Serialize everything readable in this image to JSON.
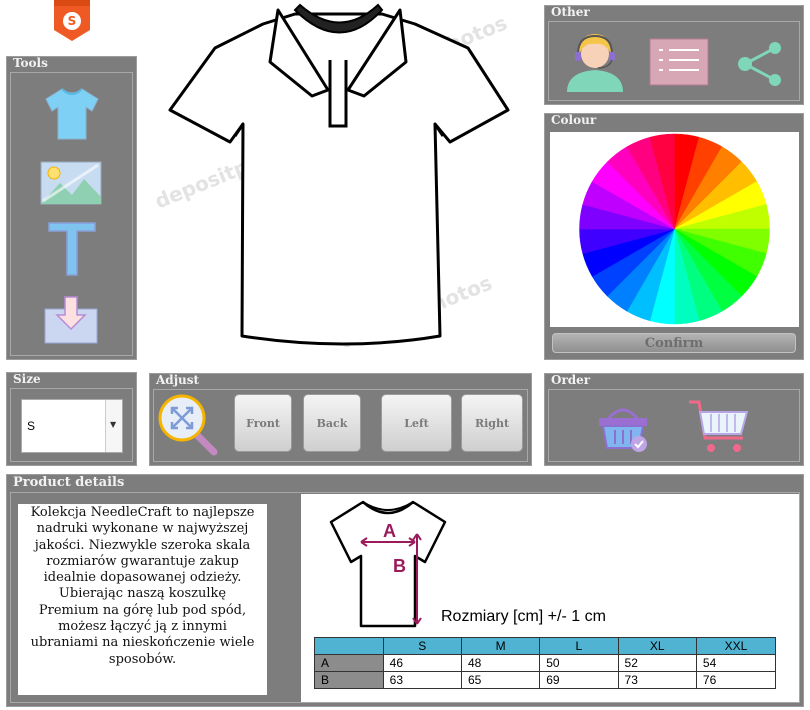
{
  "logo": {
    "letter": "S"
  },
  "panels": {
    "tools": "Tools",
    "other": "Other",
    "colour": "Colour",
    "size": "Size",
    "adjust": "Adjust",
    "order": "Order",
    "product_details": "Product details"
  },
  "colour": {
    "confirm_label": "Confirm"
  },
  "size_select": {
    "value": "S"
  },
  "adjust": {
    "buttons": [
      "Front",
      "Back",
      "Left",
      "Right"
    ]
  },
  "watermark": "depositphotos",
  "product": {
    "description": "Kolekcja NeedleCraft to najlepsze nadruki wykonane w najwyższej jakości. Niezwykle szeroka skala rozmiarów gwarantuje zakup idealnie dopasowanej odzieży. Ubierając naszą koszulkę Premium na górę lub pod spód, możesz łączyć ją z innymi ubraniami na nieskończenie wiele sposobów.",
    "diagram_label_a": "A",
    "diagram_label_b": "B",
    "sizes_caption": "Rozmiary [cm] +/- 1 cm",
    "table": {
      "headers": [
        "",
        "S",
        "M",
        "L",
        "XL",
        "XXL"
      ],
      "rows": [
        [
          "A",
          "46",
          "48",
          "50",
          "52",
          "54"
        ],
        [
          "B",
          "63",
          "65",
          "69",
          "73",
          "76"
        ]
      ]
    }
  },
  "colors": {
    "panel": "#7d7d7d",
    "table_header": "#4fb3d1",
    "measure": "#9b1a5c"
  }
}
